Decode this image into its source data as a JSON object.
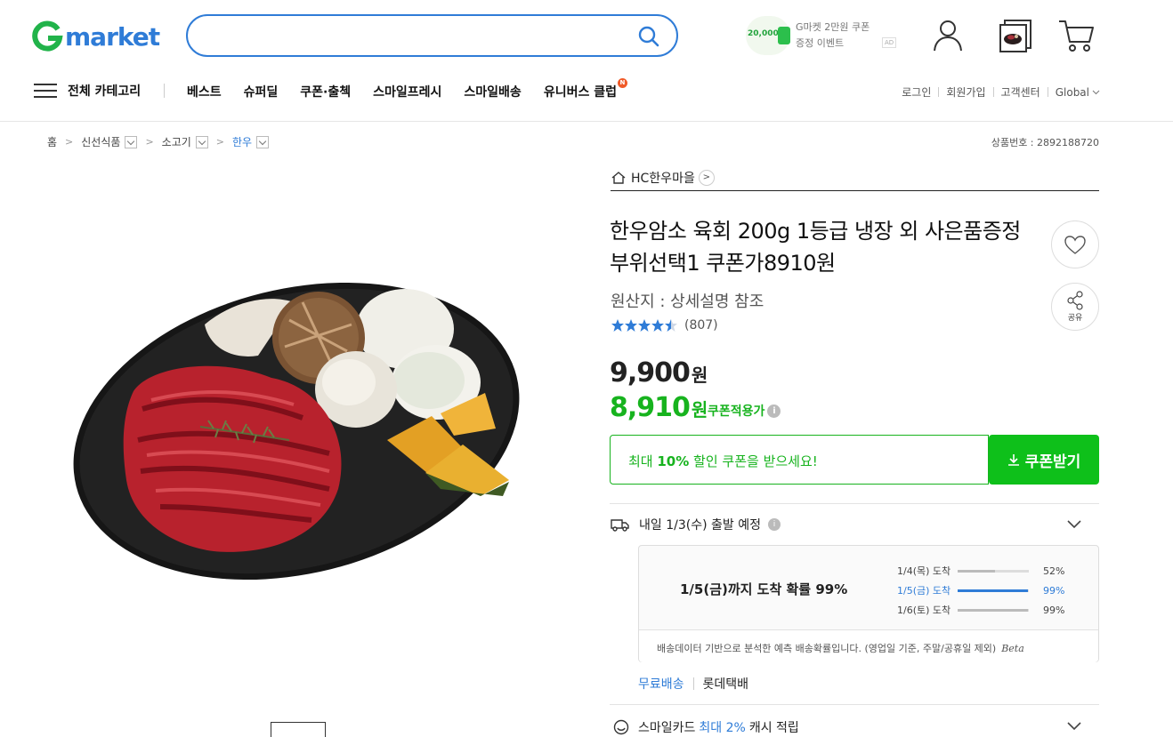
{
  "header": {
    "logo_text": "market",
    "logo_initial": "G",
    "search_placeholder": "",
    "promo": {
      "amount": "20,000",
      "line1": "G마켓 2만원 쿠폰",
      "line2": "증정 이벤트",
      "ad_label": "AD"
    }
  },
  "nav": {
    "all_categories": "전체 카테고리",
    "items": [
      "베스트",
      "슈퍼딜",
      "쿠폰·출첵",
      "스마일프레시",
      "스마일배송",
      "유니버스 클럽"
    ],
    "new_badge": "N",
    "utility": [
      "로그인",
      "회원가입",
      "고객센터",
      "Global"
    ]
  },
  "breadcrumb": {
    "home": "홈",
    "level1": "신선식품",
    "level2": "소고기",
    "level3": "한우"
  },
  "product_number": "상품번호 : 2892188720",
  "product": {
    "store_name": "HC한우마을",
    "title": "한우암소 육회 200g 1등급 냉장 외 사은품증정 부위선택1 쿠폰가8910원",
    "origin": "원산지 : 상세설명 참조",
    "rating_value": 4.5,
    "review_count": "(807)",
    "share_label": "공유",
    "original_price": "9,900",
    "coupon_price": "8,910",
    "currency": "원",
    "coupon_price_label": "쿠폰적용가",
    "coupon_banner_prefix": "최대 ",
    "coupon_banner_bold": "10%",
    "coupon_banner_suffix": " 할인 쿠폰을 받으세요!",
    "coupon_button": "쿠폰받기"
  },
  "delivery": {
    "summary": "내일 1/3(수) 출발 예정",
    "probability_headline": "1/5(금)까지 도착 확률 99%",
    "rows": [
      {
        "date": "1/4(목) 도착",
        "percent_label": "52%",
        "fill": 0.52,
        "highlight": false
      },
      {
        "date": "1/5(금) 도착",
        "percent_label": "99%",
        "fill": 0.99,
        "highlight": true
      },
      {
        "date": "1/6(토) 도착",
        "percent_label": "99%",
        "fill": 0.99,
        "highlight": false
      }
    ],
    "note": "배송데이터 기반으로 분석한 예측 배송확률입니다. (영업일 기준, 주말/공휴일 제외)",
    "beta": "Beta",
    "shipping_fee": "무료배송",
    "courier": "롯데택배"
  },
  "smilecard": {
    "prefix": "스마일카드",
    "highlight": "최대 2%",
    "suffix": "캐시 적립"
  },
  "colors": {
    "brand_blue": "#2f7cd7",
    "brand_green": "#17b31e",
    "coupon_button_green": "#0ec01a"
  }
}
